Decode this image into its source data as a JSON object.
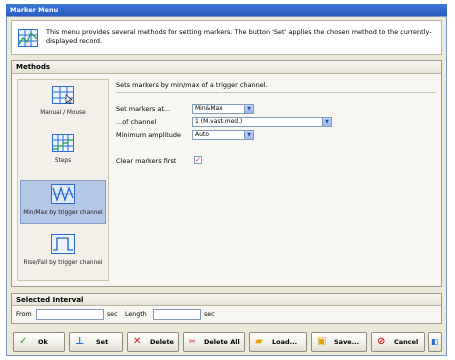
{
  "window": {
    "title": "Marker Menu"
  },
  "info": {
    "text": "This menu provides several methods for setting markers. The button 'Set' applies the chosen method to the currently-displayed record."
  },
  "methods": {
    "title": "Methods",
    "items": [
      {
        "label": "Manual / Mouse",
        "icon": "manual-mouse-icon"
      },
      {
        "label": "Steps",
        "icon": "steps-icon"
      },
      {
        "label": "Min/Max by trigger channel",
        "icon": "minmax-icon"
      },
      {
        "label": "Rise/Fall by trigger channel",
        "icon": "risefall-icon"
      }
    ],
    "selected_index": 2
  },
  "detail": {
    "title": "Sets markers by min/max of a trigger channel.",
    "set_markers_label": "Set markers at...",
    "set_markers_value": "Min&Max",
    "channel_label": "...of channel",
    "channel_value": "1 (M.vast.med.)",
    "min_amp_label": "Minimum amplitude",
    "min_amp_value": "Auto",
    "clear_label": "Clear markers first",
    "clear_checked": true
  },
  "selected_interval": {
    "title": "Selected Interval",
    "from_label": "From",
    "from_value": "",
    "sec1": "sec",
    "length_label": "Length",
    "length_value": "",
    "sec2": "sec"
  },
  "buttons": {
    "ok": "Ok",
    "set": "Set",
    "delete": "Delete",
    "delete_all": "Delete All",
    "load": "Load...",
    "save": "Save...",
    "cancel": "Cancel"
  }
}
